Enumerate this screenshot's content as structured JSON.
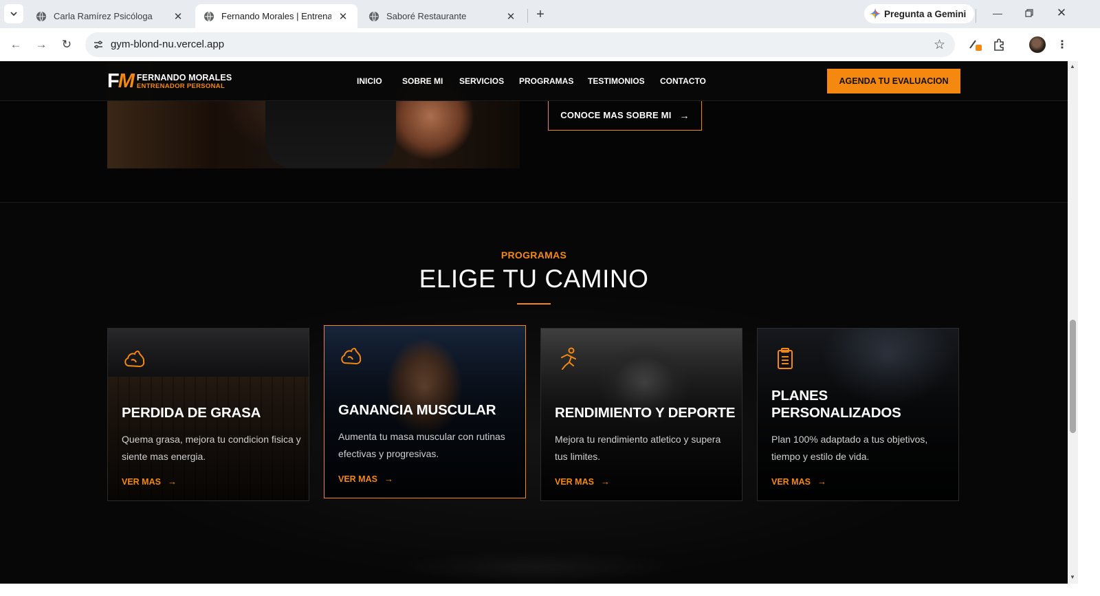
{
  "browser": {
    "tabs": [
      {
        "title": "Carla Ramírez Psicóloga",
        "active": false
      },
      {
        "title": "Fernando Morales | Entrenador",
        "active": true
      },
      {
        "title": "Saboré Restaurante",
        "active": false
      }
    ],
    "gemini_label": "Pregunta a Gemini",
    "url": "gym-blond-nu.vercel.app"
  },
  "site": {
    "logo": {
      "mark_f": "F",
      "mark_m": "M",
      "name": "FERNANDO MORALES",
      "role": "ENTRENADOR PERSONAL"
    },
    "nav": [
      "INICIO",
      "SOBRE MI",
      "SERVICIOS",
      "PROGRAMAS",
      "TESTIMONIOS",
      "CONTACTO"
    ],
    "header_cta": "AGENDA TU EVALUACION",
    "about_cta": "CONOCE MAS SOBRE MI",
    "accent_color": "#f5880f"
  },
  "programs": {
    "eyebrow": "PROGRAMAS",
    "heading": "ELIGE TU CAMINO",
    "cards": [
      {
        "icon": "flame-icon",
        "title": "PERDIDA DE GRASA",
        "description": "Quema grasa, mejora tu condicion fisica y siente mas energia.",
        "link": "VER MAS"
      },
      {
        "icon": "flame-icon",
        "title": "GANANCIA MUSCULAR",
        "description": "Aumenta tu masa muscular con rutinas efectivas y progresivas.",
        "link": "VER MAS"
      },
      {
        "icon": "running-icon",
        "title": "RENDIMIENTO Y DEPORTE",
        "description": "Mejora tu rendimiento atletico y supera tus limites.",
        "link": "VER MAS"
      },
      {
        "icon": "clipboard-icon",
        "title": "PLANES PERSONALIZADOS",
        "description": "Plan 100% adaptado a tus objetivos, tiempo y estilo de vida.",
        "link": "VER MAS"
      }
    ]
  }
}
